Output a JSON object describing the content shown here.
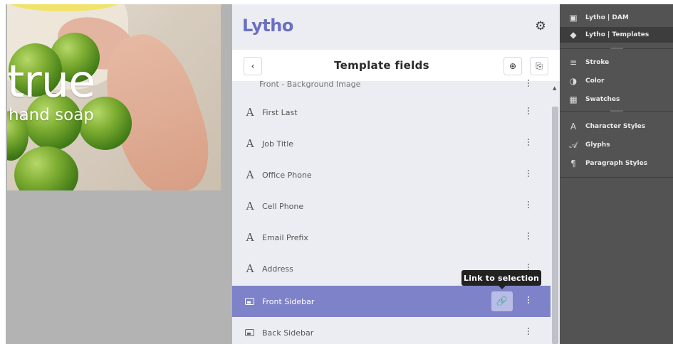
{
  "artwork": {
    "headline": "true",
    "subline": "hand soap"
  },
  "plugin": {
    "logo": "Lytho",
    "title": "Template fields",
    "fields": [
      {
        "label": "Front - Background Image",
        "icon": "image-icon"
      },
      {
        "label": "First Last",
        "icon": "text-icon",
        "glyph": "A"
      },
      {
        "label": "Job Title",
        "icon": "text-icon",
        "glyph": "A"
      },
      {
        "label": "Office Phone",
        "icon": "text-icon",
        "glyph": "A"
      },
      {
        "label": "Cell Phone",
        "icon": "text-icon",
        "glyph": "A"
      },
      {
        "label": "Email Prefix",
        "icon": "text-icon",
        "glyph": "A"
      },
      {
        "label": "Address",
        "icon": "text-icon",
        "glyph": "A"
      },
      {
        "label": "Front Sidebar",
        "icon": "image-icon",
        "selected": true
      },
      {
        "label": "Back Sidebar",
        "icon": "image-icon"
      }
    ],
    "tooltip": "Link to selection",
    "colors": {
      "accent": "#7e82c8",
      "logo": "#6b6fc2",
      "panel_bg": "#ebedf3"
    }
  },
  "right_panel": {
    "items": [
      {
        "label": "Lytho | DAM",
        "icon": "dam-icon"
      },
      {
        "label": "Lytho | Templates",
        "icon": "templates-icon",
        "active": true
      },
      {
        "label": "Stroke",
        "icon": "stroke-icon"
      },
      {
        "label": "Color",
        "icon": "color-icon"
      },
      {
        "label": "Swatches",
        "icon": "swatches-icon"
      },
      {
        "label": "Character Styles",
        "icon": "character-styles-icon"
      },
      {
        "label": "Glyphs",
        "icon": "glyphs-icon"
      },
      {
        "label": "Paragraph Styles",
        "icon": "paragraph-styles-icon"
      }
    ]
  }
}
